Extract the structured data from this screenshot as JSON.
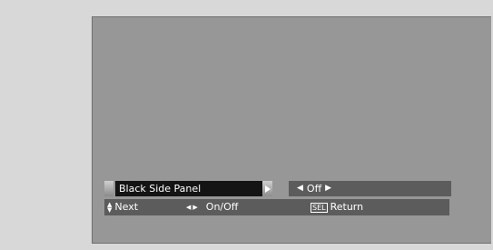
{
  "menu": {
    "item_label": "Black Side Panel",
    "value": "Off"
  },
  "help": {
    "next_label": "Next",
    "onoff_label": "On/Off",
    "sel_key": "SEL",
    "return_label": "Return"
  },
  "colors": {
    "screen_bg": "#979797",
    "page_bg": "#d8d8d8",
    "label_bg": "#141414",
    "bar_bg": "#5c5c5c"
  }
}
